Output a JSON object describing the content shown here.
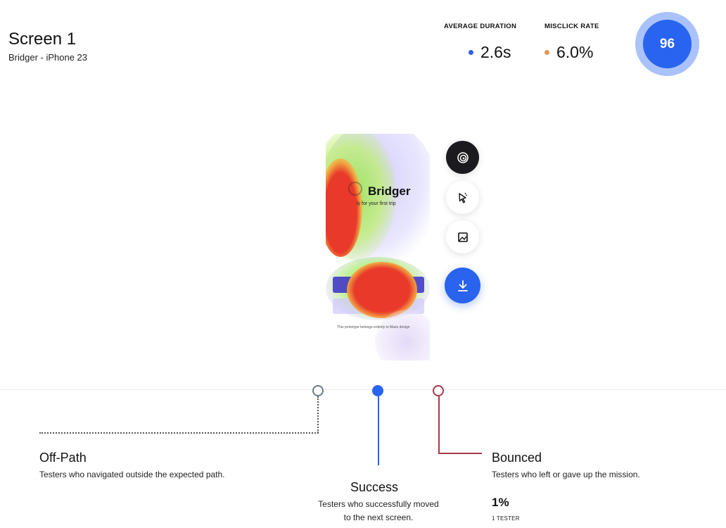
{
  "header": {
    "title": "Screen 1",
    "subtitle": "Bridger - iPhone 23"
  },
  "metrics": {
    "average_duration": {
      "label": "AVERAGE DURATION",
      "value": "2.6s",
      "color": "#2b62e6"
    },
    "misclick_rate": {
      "label": "MISCLICK RATE",
      "value": "6.0%",
      "color": "#e3955a"
    },
    "score": "96"
  },
  "phone": {
    "brand": "Bridger",
    "tagline": "ly for your first trip",
    "footnote": "This prototype belongs entirely to Maze design"
  },
  "tools": [
    "heatmap-icon",
    "cursor-click-icon",
    "image-icon",
    "download-icon"
  ],
  "paths": {
    "off_path": {
      "title": "Off-Path",
      "description": "Testers who navigated outside the expected path."
    },
    "success": {
      "title": "Success",
      "description_line1": "Testers who successfully moved",
      "description_line2": "to the next screen."
    },
    "bounced": {
      "title": "Bounced",
      "description": "Testers who left or gave up the mission.",
      "percent": "1%",
      "testers": "1 TESTER"
    }
  },
  "colors": {
    "accent": "#2864f0",
    "bounced": "#a33a4a",
    "off_path": "#6c7b8e"
  }
}
